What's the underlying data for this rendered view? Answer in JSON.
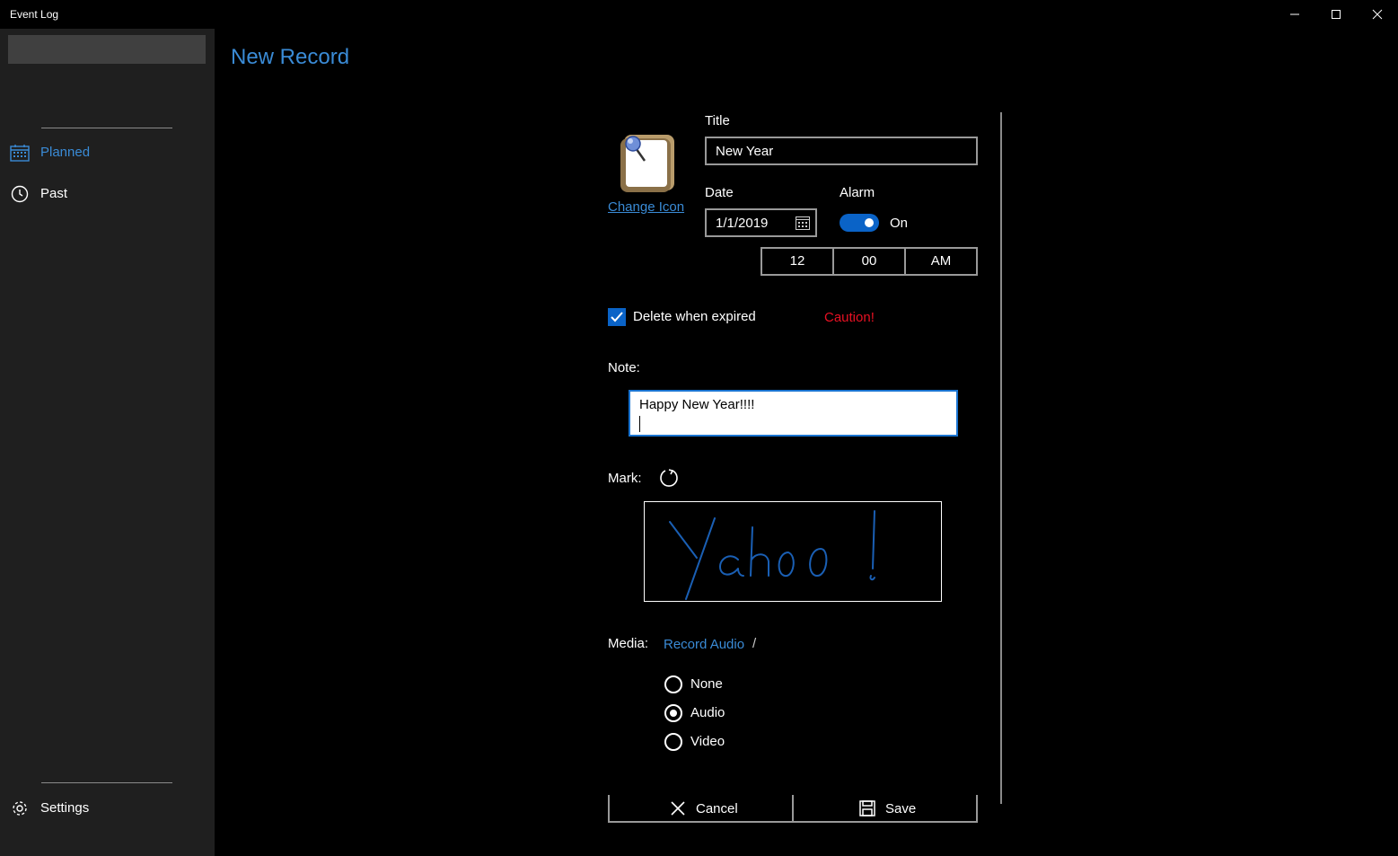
{
  "window": {
    "title": "Event Log"
  },
  "sidebar": {
    "items": [
      {
        "label": "Planned",
        "icon": "calendar-icon",
        "selected": true
      },
      {
        "label": "Past",
        "icon": "clock-icon",
        "selected": false
      }
    ],
    "settings_label": "Settings"
  },
  "page": {
    "title": "New Record"
  },
  "form": {
    "change_icon_label": "Change Icon",
    "title_label": "Title",
    "title_value": "New Year",
    "date_label": "Date",
    "date_value": "1/1/2019",
    "alarm_label": "Alarm",
    "alarm_state": "On",
    "time": {
      "hour": "12",
      "minute": "00",
      "period": "AM"
    },
    "delete_when_expired_label": "Delete when expired",
    "delete_when_expired_checked": true,
    "caution_label": "Caution!",
    "note_label": "Note:",
    "note_value": "Happy New Year!!!!",
    "mark_label": "Mark:",
    "mark_ink_text": "Yahoo!",
    "media_label": "Media:",
    "record_audio_label": "Record Audio",
    "media_separator": "/",
    "media_options": [
      {
        "label": "None",
        "checked": false
      },
      {
        "label": "Audio",
        "checked": true
      },
      {
        "label": "Video",
        "checked": false
      }
    ],
    "cancel_label": "Cancel",
    "save_label": "Save"
  },
  "colors": {
    "accent": "#3a8bd6",
    "toggle_on": "#0a63c7",
    "caution": "#e81123",
    "sidebar_bg": "#1f1f1f",
    "ink": "#1a5fb4"
  }
}
